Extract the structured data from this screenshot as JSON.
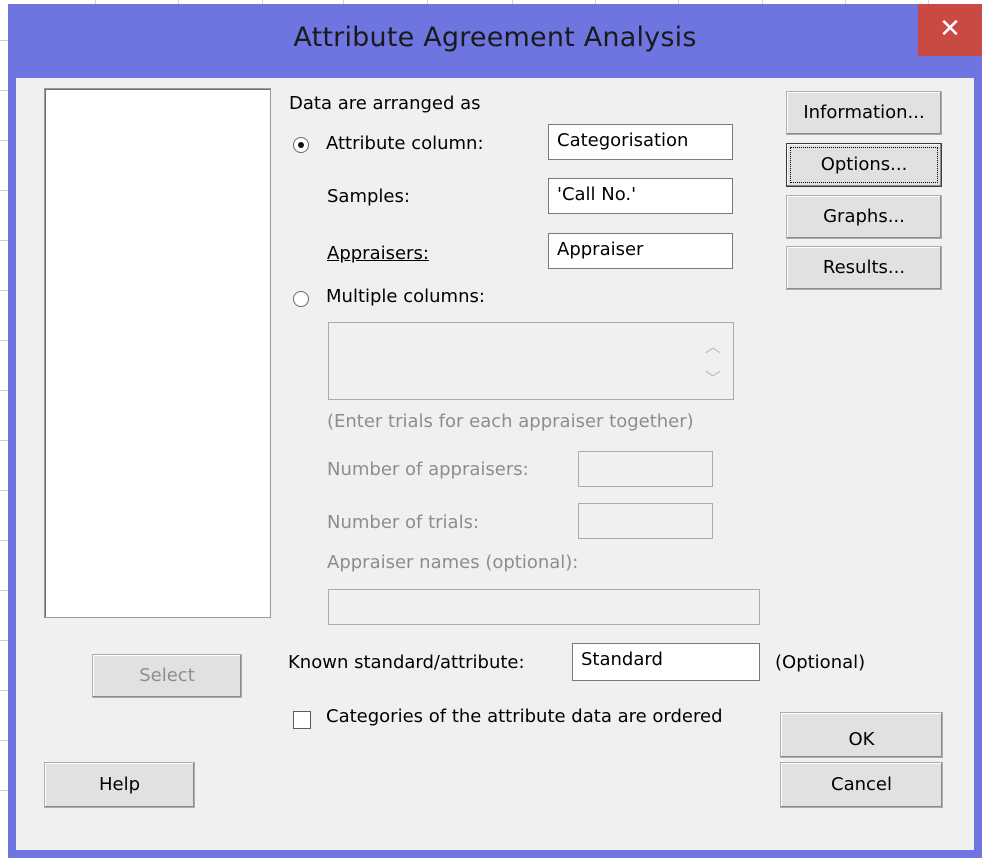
{
  "window": {
    "title": "Attribute Agreement Analysis",
    "close_glyph": "✕"
  },
  "arrange": {
    "heading": "Data are arranged as",
    "attribute_column": {
      "label": "Attribute column:",
      "value": "Categorisation",
      "selected": true
    },
    "samples": {
      "label": "Samples:",
      "value": "'Call No.'"
    },
    "appraisers": {
      "label": "Appraisers:",
      "value": "Appraiser"
    },
    "multiple_columns": {
      "label": "Multiple columns:",
      "selected": false
    },
    "trials_hint": "(Enter trials for each appraiser together)",
    "num_appraisers": {
      "label": "Number of appraisers:",
      "value": ""
    },
    "num_trials": {
      "label": "Number of trials:",
      "value": ""
    },
    "appraiser_names": {
      "label": "Appraiser names (optional):",
      "value": ""
    }
  },
  "known_standard": {
    "label": "Known standard/attribute:",
    "value": "Standard",
    "note": "(Optional)"
  },
  "ordered": {
    "label": "Categories of the attribute data are ordered",
    "checked": false
  },
  "buttons": {
    "select": "Select",
    "help": "Help",
    "information": "Information...",
    "options": "Options...",
    "graphs": "Graphs...",
    "results": "Results...",
    "ok": "OK",
    "cancel": "Cancel"
  },
  "icons": {
    "scroll_up": "chevron-up-icon",
    "scroll_down": "chevron-down-icon",
    "close": "close-icon"
  },
  "colors": {
    "titlebar": "#6f75e0",
    "close": "#c94a42",
    "client": "#f0f0f0"
  }
}
